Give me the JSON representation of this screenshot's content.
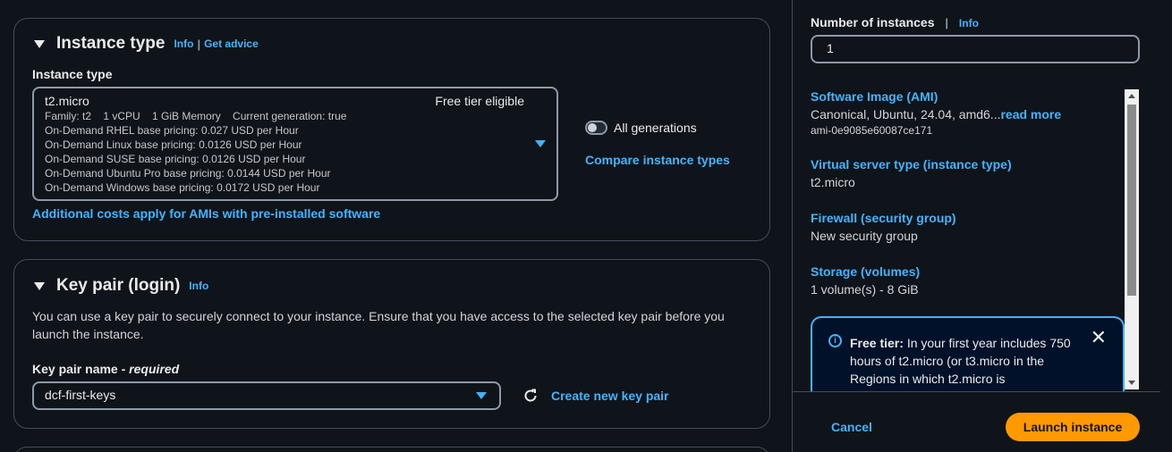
{
  "instance_type_section": {
    "title": "Instance type",
    "info": "Info",
    "get_advice": "Get advice",
    "field_label": "Instance type",
    "selected": {
      "name": "t2.micro",
      "free_tier": "Free tier eligible",
      "details": "Family: t2    1 vCPU    1 GiB Memory    Current generation: true",
      "pricing": [
        "On-Demand RHEL base pricing: 0.027 USD per Hour",
        "On-Demand Linux base pricing: 0.0126 USD per Hour",
        "On-Demand SUSE base pricing: 0.0126 USD per Hour",
        "On-Demand Ubuntu Pro base pricing: 0.0144 USD per Hour",
        "On-Demand Windows base pricing: 0.0172 USD per Hour"
      ]
    },
    "all_generations": "All generations",
    "compare": "Compare instance types",
    "additional_costs": "Additional costs apply for AMIs with pre-installed software"
  },
  "key_pair_section": {
    "title": "Key pair (login)",
    "info": "Info",
    "description": "You can use a key pair to securely connect to your instance. Ensure that you have access to the selected key pair before you launch the instance.",
    "field_label": "Key pair name",
    "required": "- required",
    "selected": "dcf-first-keys",
    "create_new": "Create new key pair"
  },
  "summary": {
    "num_instances_label": "Number of instances",
    "info": "Info",
    "num_instances_value": "1",
    "ami_label": "Software Image (AMI)",
    "ami_value": "Canonical, Ubuntu, 24.04, amd6...",
    "read_more": "read more",
    "ami_id": "ami-0e9085e60087ce171",
    "server_type_label": "Virtual server type (instance type)",
    "server_type_value": "t2.micro",
    "firewall_label": "Firewall (security group)",
    "firewall_value": "New security group",
    "storage_label": "Storage (volumes)",
    "storage_value": "1 volume(s) - 8 GiB",
    "free_tier_title": "Free tier:",
    "free_tier_text": "In your first year includes 750 hours of t2.micro (or t3.micro in the Regions in which t2.micro is",
    "cancel": "Cancel",
    "launch": "Launch instance"
  },
  "colors": {
    "background": "#0f141a",
    "link": "#42b4ff",
    "primary_button": "#ff9900",
    "border": "#414d5c"
  }
}
